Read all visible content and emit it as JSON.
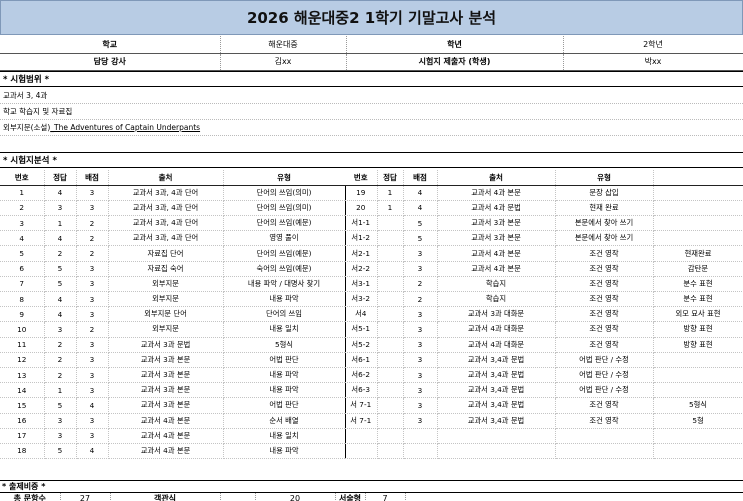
{
  "title": "2026 해운대중2 1학기 기말고사 분석",
  "info": {
    "school_label": "학교",
    "school_value": "해운대중",
    "grade_label": "학년",
    "grade_value": "2학년",
    "teacher_label": "담당 강사",
    "teacher_value": "김xx",
    "submitter_label": "시험지 제출자 (학생)",
    "submitter_value": "박xx"
  },
  "scope": {
    "heading": "* 시험범위 *",
    "items": [
      "교과서 3, 4과",
      "학교 학습지 및 자료집"
    ],
    "external_prefix": "외부지문(소설)",
    "external_title": "_The Adventures of Captain Underpants"
  },
  "analysis": {
    "heading": "* 시험지분석 *",
    "headers": [
      "번호",
      "정답",
      "배점",
      "출처",
      "유형"
    ],
    "left_rows": [
      [
        "1",
        "4",
        "3",
        "교과서 3과, 4과 단어",
        "단어의 쓰임(의미)"
      ],
      [
        "2",
        "3",
        "3",
        "교과서 3과, 4과 단어",
        "단어의 쓰임(의미)"
      ],
      [
        "3",
        "1",
        "2",
        "교과서 3과, 4과 단어",
        "단어의 쓰임(예문)"
      ],
      [
        "4",
        "4",
        "2",
        "교과서 3과, 4과 단어",
        "영영 풀이"
      ],
      [
        "5",
        "2",
        "2",
        "자료집 단어",
        "단어의 쓰임(예문)"
      ],
      [
        "6",
        "5",
        "3",
        "자료집 숙어",
        "숙어의 쓰임(예문)"
      ],
      [
        "7",
        "5",
        "3",
        "외부지문",
        "내용 파악 / 대명사 찾기"
      ],
      [
        "8",
        "4",
        "3",
        "외부지문",
        "내용 파악"
      ],
      [
        "9",
        "4",
        "3",
        "외부지문 단어",
        "단어의 쓰임"
      ],
      [
        "10",
        "3",
        "2",
        "외부지문",
        "내용 일치"
      ],
      [
        "11",
        "2",
        "3",
        "교과서 3과 문법",
        "5형식"
      ],
      [
        "12",
        "2",
        "3",
        "교과서 3과 본문",
        "어법 판단"
      ],
      [
        "13",
        "2",
        "3",
        "교과서 3과 본문",
        "내용 파악"
      ],
      [
        "14",
        "1",
        "3",
        "교과서 3과 본문",
        "내용 파악"
      ],
      [
        "15",
        "5",
        "4",
        "교과서 3과 본문",
        "어법 판단"
      ],
      [
        "16",
        "3",
        "3",
        "교과서 4과 본문",
        "순서 배열"
      ],
      [
        "17",
        "3",
        "3",
        "교과서 4과 본문",
        "내용 일치"
      ],
      [
        "18",
        "5",
        "4",
        "교과서 4과 본문",
        "내용 파악"
      ]
    ],
    "right_rows": [
      [
        "19",
        "1",
        "4",
        "교과서 4과 본문",
        "문장 삽입",
        ""
      ],
      [
        "20",
        "1",
        "4",
        "교과서 4과 문법",
        "현재 완료",
        ""
      ],
      [
        "서1-1",
        "",
        "5",
        "교과서 3과 본문",
        "본문에서 찾아 쓰기",
        ""
      ],
      [
        "서1-2",
        "",
        "5",
        "교과서 3과 본문",
        "본문에서 찾아 쓰기",
        ""
      ],
      [
        "서2-1",
        "",
        "3",
        "교과서 4과 본문",
        "조건 영작",
        "현재완료"
      ],
      [
        "서2-2",
        "",
        "3",
        "교과서 4과 본문",
        "조건 영작",
        "감탄문"
      ],
      [
        "서3-1",
        "",
        "2",
        "학습지",
        "조건 영작",
        "분수 표현"
      ],
      [
        "서3-2",
        "",
        "2",
        "학습지",
        "조건 영작",
        "분수 표현"
      ],
      [
        "서4",
        "",
        "3",
        "교과서 3과 대화문",
        "조건 영작",
        "외모 묘사 표현"
      ],
      [
        "서5-1",
        "",
        "3",
        "교과서 4과 대화문",
        "조건 영작",
        "방향 표현"
      ],
      [
        "서5-2",
        "",
        "3",
        "교과서 4과 대화문",
        "조건 영작",
        "방향 표현"
      ],
      [
        "서6-1",
        "",
        "3",
        "교과서 3,4과 문법",
        "어법 판단 / 수정",
        ""
      ],
      [
        "서6-2",
        "",
        "3",
        "교과서 3,4과 문법",
        "어법 판단 / 수정",
        ""
      ],
      [
        "서6-3",
        "",
        "3",
        "교과서 3,4과 문법",
        "어법 판단 / 수정",
        ""
      ],
      [
        "서 7-1",
        "",
        "3",
        "교과서 3,4과 문법",
        "조건 영작",
        "5형식"
      ],
      [
        "서 7-1",
        "",
        "3",
        "교과서 3,4과 문법",
        "조건 영작",
        "5형"
      ],
      [
        "",
        "",
        "",
        "",
        "",
        ""
      ],
      [
        "",
        "",
        "",
        "",
        "",
        ""
      ]
    ]
  },
  "ratio": {
    "heading": "* 출제비중 *",
    "total_label": "총 문항수",
    "total_value": "27",
    "objective_label": "객관식",
    "objective_value": "20",
    "subjective_label": "서술형",
    "subjective_value": "7"
  }
}
